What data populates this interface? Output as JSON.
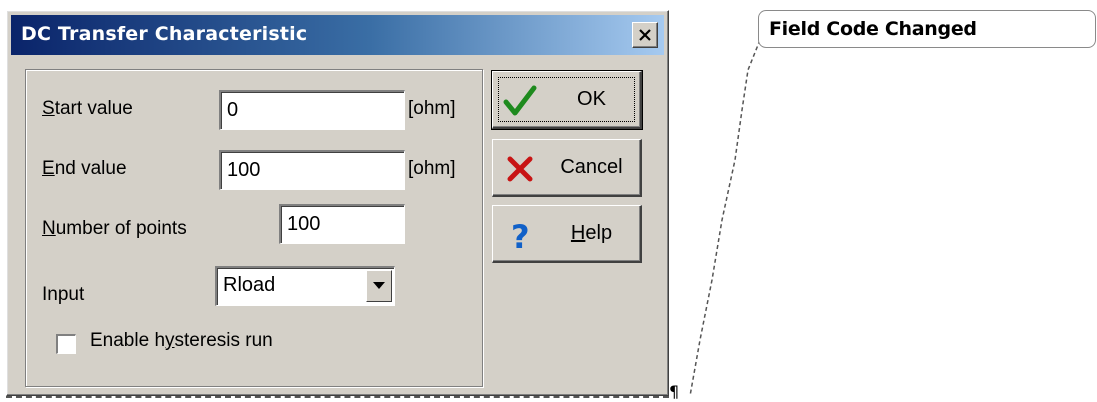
{
  "dialog": {
    "title": "DC Transfer Characteristic",
    "close_label": "✕",
    "fields": {
      "start": {
        "label_mnemonic": "S",
        "label_rest": "tart value",
        "value": "0",
        "unit": "[ohm]"
      },
      "end": {
        "label_mnemonic": "E",
        "label_rest": "nd value",
        "value": "100",
        "unit": "[ohm]"
      },
      "points": {
        "label_mnemonic": "N",
        "label_rest": "umber of points",
        "value": "100"
      },
      "input": {
        "label": "Input",
        "value": "Rload"
      }
    },
    "hysteresis": {
      "label_pre": "Enable h",
      "label_mnemonic": "y",
      "label_post": "steresis run",
      "checked": false
    },
    "buttons": {
      "ok": "OK",
      "cancel": "Cancel",
      "help_mnemonic": "H",
      "help_rest": "elp"
    }
  },
  "comment": {
    "text": "Field Code Changed"
  },
  "colors": {
    "title_start": "#0a246a",
    "title_end": "#a6caf0",
    "dialog_face": "#d4d0c8"
  }
}
